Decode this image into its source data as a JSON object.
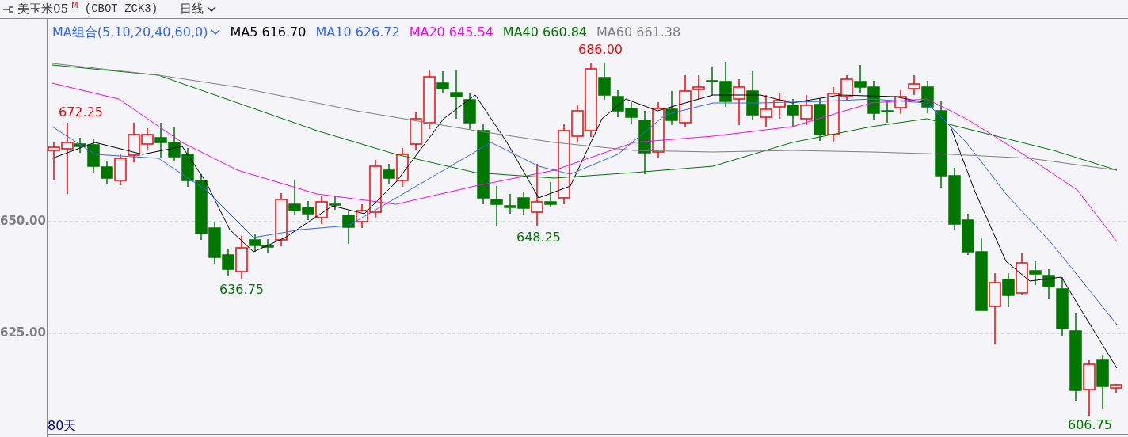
{
  "header": {
    "title": "美玉米05",
    "badge": "M",
    "code": "(CBOT ZCK3)",
    "period": "日线"
  },
  "legend": {
    "selector": "MA组合(5,10,20,40,60,0)",
    "items": [
      {
        "label": "MA5 616.70",
        "color": "#000000"
      },
      {
        "label": "MA10 626.72",
        "color": "#3366ff"
      },
      {
        "label": "MA20 645.54",
        "color": "#ff00ff"
      },
      {
        "label": "MA40 660.84",
        "color": "#007700"
      },
      {
        "label": "MA60 661.38",
        "color": "#808080"
      }
    ]
  },
  "y_axis": {
    "ticks": [
      "650.00",
      "625.00"
    ]
  },
  "price_labels": [
    {
      "text": "672.25",
      "kind": "high"
    },
    {
      "text": "636.75",
      "kind": "low"
    },
    {
      "text": "648.25",
      "kind": "low"
    },
    {
      "text": "686.00",
      "kind": "high"
    },
    {
      "text": "606.75",
      "kind": "low"
    }
  ],
  "range_label": "80天"
}
